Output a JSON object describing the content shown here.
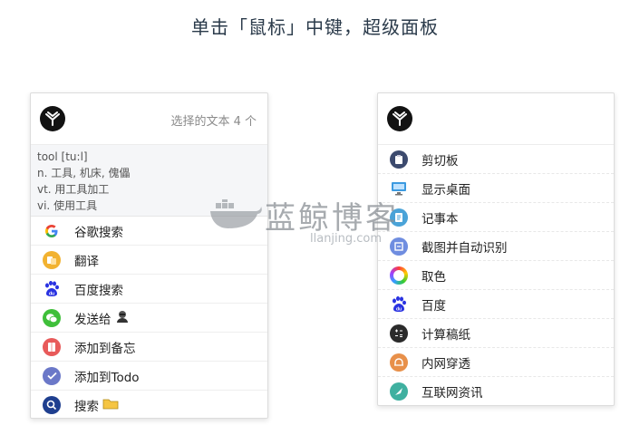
{
  "title": "单击「鼠标」中键，超级面板",
  "left_panel": {
    "selection_info": "选择的文本 4 个",
    "dict": [
      "tool [tu:l]",
      "n. 工具, 机床, 傀儡",
      "vt. 用工具加工",
      "vi. 使用工具"
    ],
    "items": [
      {
        "label": "谷歌搜索",
        "icon": "google-icon"
      },
      {
        "label": "翻译",
        "icon": "translate-icon"
      },
      {
        "label": "百度搜索",
        "icon": "baidu-icon"
      },
      {
        "label": "发送给",
        "icon": "wechat-icon"
      },
      {
        "label": "添加到备忘",
        "icon": "memo-icon"
      },
      {
        "label": "添加到Todo",
        "icon": "todo-icon"
      },
      {
        "label": "搜索",
        "icon": "search-icon"
      }
    ]
  },
  "right_panel": {
    "items": [
      {
        "label": "剪切板",
        "icon": "clipboard-icon"
      },
      {
        "label": "显示桌面",
        "icon": "desktop-icon"
      },
      {
        "label": "记事本",
        "icon": "notepad-icon"
      },
      {
        "label": "截图并自动识别",
        "icon": "screenshot-ocr-icon"
      },
      {
        "label": "取色",
        "icon": "color-picker-icon"
      },
      {
        "label": "百度",
        "icon": "baidu-icon"
      },
      {
        "label": "计算稿纸",
        "icon": "calculator-icon"
      },
      {
        "label": "内网穿透",
        "icon": "tunnel-icon"
      },
      {
        "label": "互联网资讯",
        "icon": "news-icon"
      }
    ]
  },
  "watermark": {
    "text": "蓝鲸博客",
    "sub": "llanjing.com"
  },
  "colors": {
    "accent": "#2a3a4a",
    "logo": "#121212"
  }
}
